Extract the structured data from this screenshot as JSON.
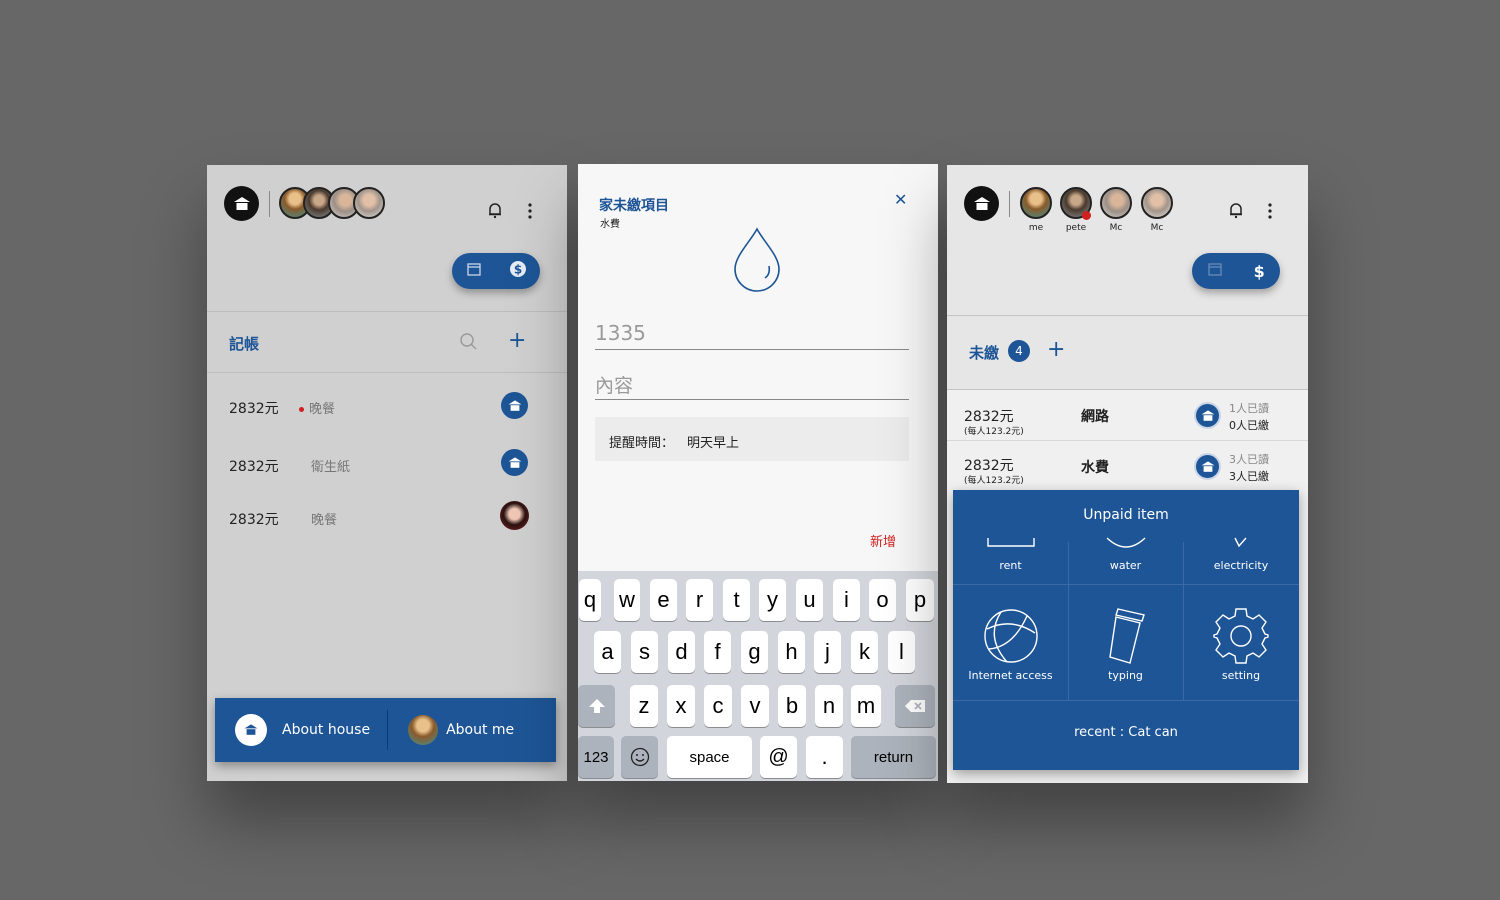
{
  "colors": {
    "brand_blue": "#1d5596",
    "alert_red": "#d02020",
    "background": "#676767"
  },
  "screen1": {
    "section_title": "記帳",
    "rows": [
      {
        "amount": "2832元",
        "note": "晚餐",
        "unread": true,
        "icon": "house-icon"
      },
      {
        "amount": "2832元",
        "note": "衛生紙",
        "unread": false,
        "icon": "house-icon"
      },
      {
        "amount": "2832元",
        "note": "晚餐",
        "unread": false,
        "icon": "avatar"
      }
    ],
    "bottom_bar": {
      "about_house": "About house",
      "about_me": "About me"
    }
  },
  "screen2": {
    "title": "家未繳項目",
    "subtitle": "水費",
    "amount_value": "1335",
    "content_placeholder": "內容",
    "reminder_label": "提醒時間：",
    "reminder_value": "明天早上",
    "add_button": "新增",
    "keyboard": {
      "row1": [
        "q",
        "w",
        "e",
        "r",
        "t",
        "y",
        "u",
        "i",
        "o",
        "p"
      ],
      "row2": [
        "a",
        "s",
        "d",
        "f",
        "g",
        "h",
        "j",
        "k",
        "l"
      ],
      "row3": [
        "z",
        "x",
        "c",
        "v",
        "b",
        "n",
        "m"
      ],
      "numbers": "123",
      "space": "space",
      "at": "@",
      "dot": ".",
      "return": "return"
    }
  },
  "screen3": {
    "members": [
      "me",
      "pete",
      "Mc",
      "Mc"
    ],
    "section_title": "未繳",
    "unpaid_count": "4",
    "rows": [
      {
        "amount": "2832元",
        "per_person": "(每人123.2元)",
        "name": "網路",
        "read": "1人已讀",
        "paid": "0人已繳"
      },
      {
        "amount": "2832元",
        "per_person": "(每人123.2元)",
        "name": "水費",
        "read": "3人已讀",
        "paid": "3人已繳"
      }
    ],
    "popup": {
      "title": "Unpaid item",
      "items": [
        "rent",
        "water",
        "electricity",
        "Internet access",
        "typing",
        "setting"
      ],
      "recent": "recent : Cat can"
    }
  }
}
